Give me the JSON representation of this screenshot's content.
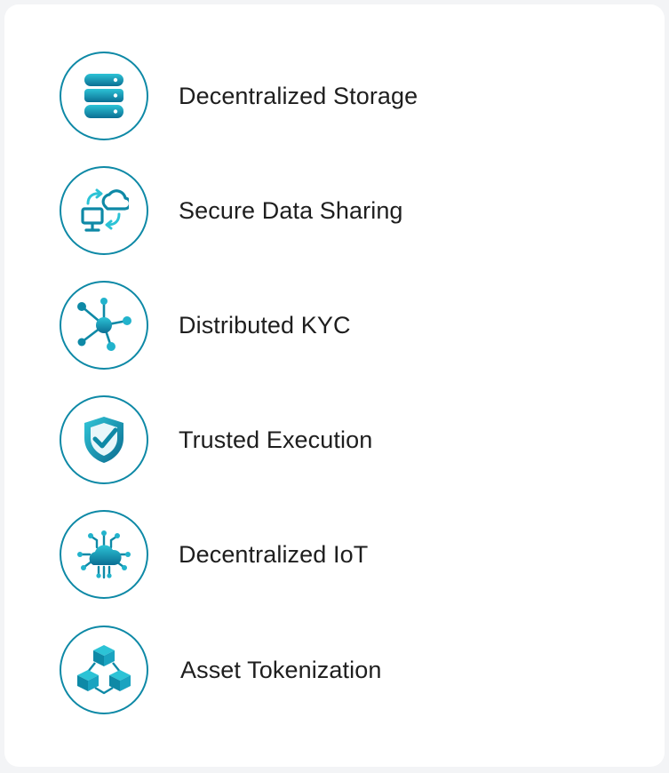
{
  "features": [
    {
      "label": "Decentralized Storage",
      "icon": "database-icon"
    },
    {
      "label": "Secure Data Sharing",
      "icon": "cloud-sync-monitor-icon"
    },
    {
      "label": "Distributed KYC",
      "icon": "network-nodes-icon"
    },
    {
      "label": "Trusted Execution",
      "icon": "shield-check-icon"
    },
    {
      "label": "Decentralized IoT",
      "icon": "cloud-circuit-icon"
    },
    {
      "label": "Asset Tokenization",
      "icon": "linked-cubes-icon"
    }
  ],
  "colors": {
    "accent": "#0e89a6",
    "accent_light": "#2cc3d6",
    "text": "#1e1e1e",
    "card": "#ffffff",
    "background": "#f3f4f6"
  }
}
